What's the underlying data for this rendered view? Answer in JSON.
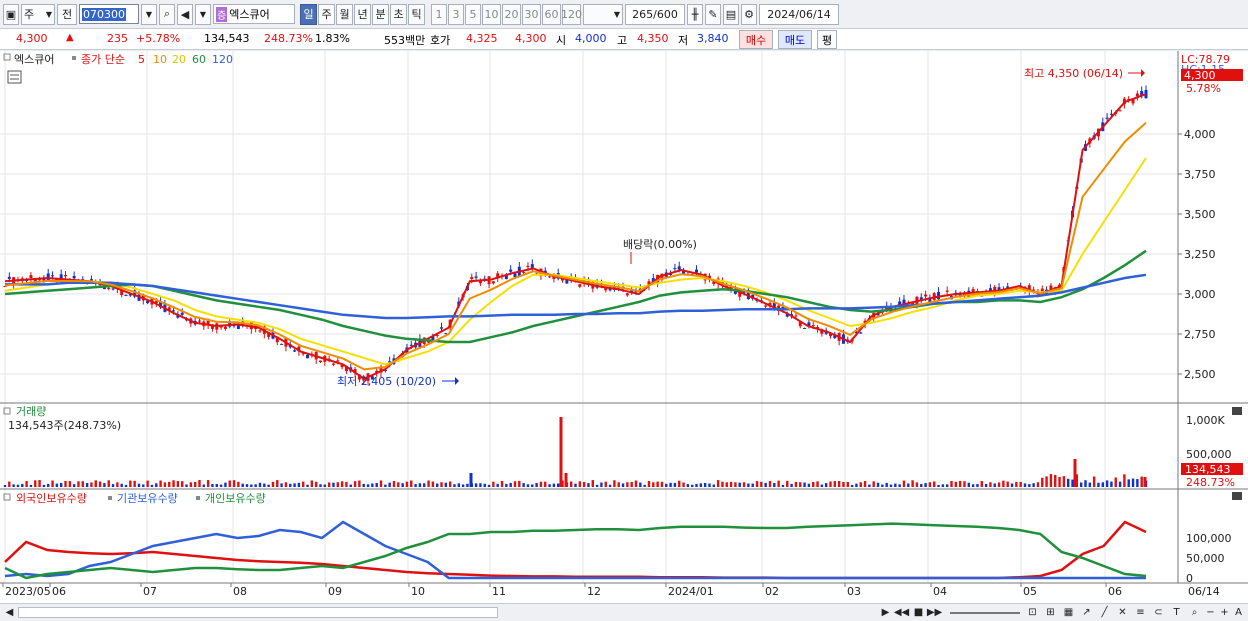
{
  "toolbar": {
    "period_type": "주",
    "prev_label": "전",
    "stock_code": "070300",
    "stock_name": "엑스큐어",
    "stock_tag": "증",
    "timeframes": [
      "일",
      "주",
      "월",
      "년",
      "분",
      "초",
      "틱"
    ],
    "active_timeframe": "일",
    "intervals": [
      "1",
      "3",
      "5",
      "10",
      "20",
      "30",
      "60",
      "120"
    ],
    "count_value": "265",
    "count_total": "/600",
    "date": "2024/06/14"
  },
  "quote": {
    "price": "4,300",
    "arrow": "▲",
    "change": "235",
    "change_pct": "+5.78%",
    "volume": "134,543",
    "volume_ratio": "248.73%",
    "turnover": "1.83%",
    "amount": "553백만",
    "ask_label": "호가",
    "ask": "4,325",
    "bid": "4,300",
    "open_label": "시",
    "open": "4,000",
    "high_label": "고",
    "high": "4,350",
    "low_label": "저",
    "low": "3,840",
    "buy_label": "매수",
    "sell_label": "매도",
    "avg_label": "평"
  },
  "legend": {
    "name": "엑스큐어",
    "ma_label": "종가 단순",
    "ma_periods": [
      "5",
      "10",
      "20",
      "60",
      "120"
    ],
    "ma_colors": [
      "#e01010",
      "#f08c00",
      "#f5e000",
      "#20903c",
      "#3060d8"
    ]
  },
  "price_panel": {
    "lc_label": "LC:78.79",
    "hc_label": "HC:1.15",
    "price_badge": "4,300",
    "pct_badge": "5.78%",
    "y_ticks": [
      "4,000",
      "3,750",
      "3,500",
      "3,250",
      "3,000",
      "2,750",
      "2,500"
    ],
    "high_annot": "최고 4,350 (06/14)",
    "low_annot": "최저 2,405 (10/20)",
    "div_annot": "배당락(0.00%)"
  },
  "volume_panel": {
    "title": "거래량",
    "subtitle": "134,543주(248.73%)",
    "y_ticks": [
      "1,000K",
      "500,000"
    ],
    "vol_badge": "134,543",
    "vol_pct": "248.73%"
  },
  "holdings_panel": {
    "series": [
      "외국인보유수량",
      "기관보유수량",
      "개인보유수량"
    ],
    "series_colors": [
      "#e01010",
      "#3060d8",
      "#20903c"
    ],
    "y_ticks": [
      "100,000",
      "50,000",
      "0"
    ]
  },
  "x_axis": [
    "2023/05",
    "06",
    "07",
    "08",
    "09",
    "10",
    "11",
    "12",
    "2024/01",
    "02",
    "03",
    "04",
    "05",
    "06",
    "06/14"
  ],
  "chart_data": {
    "type": "line",
    "title": "엑스큐어",
    "price_range": [
      2405,
      4350
    ],
    "series": [
      {
        "name": "5",
        "values": [
          3080,
          3090,
          3100,
          3090,
          3080,
          3050,
          3000,
          2950,
          2880,
          2820,
          2800,
          2810,
          2790,
          2720,
          2640,
          2600,
          2560,
          2470,
          2530,
          2650,
          2720,
          2790,
          3080,
          3090,
          3130,
          3160,
          3110,
          3080,
          3050,
          3030,
          3000,
          3110,
          3150,
          3120,
          3050,
          3000,
          2940,
          2880,
          2800,
          2760,
          2700,
          2860,
          2920,
          2950,
          2980,
          3000,
          3010,
          3020,
          3050,
          3000,
          3050,
          3900,
          4050,
          4200,
          4250
        ]
      },
      {
        "name": "20",
        "values": [
          3020,
          3040,
          3060,
          3070,
          3080,
          3070,
          3040,
          3000,
          2960,
          2900,
          2860,
          2840,
          2820,
          2780,
          2720,
          2680,
          2640,
          2600,
          2560,
          2600,
          2640,
          2700,
          2840,
          2950,
          3050,
          3120,
          3120,
          3100,
          3080,
          3060,
          3040,
          3070,
          3090,
          3100,
          3080,
          3050,
          3010,
          2960,
          2900,
          2850,
          2800,
          2820,
          2850,
          2890,
          2920,
          2960,
          2990,
          3000,
          3020,
          3010,
          3020,
          3250,
          3450,
          3650,
          3850
        ]
      },
      {
        "name": "60",
        "values": [
          3000,
          3010,
          3020,
          3030,
          3040,
          3050,
          3060,
          3050,
          3020,
          2990,
          2960,
          2940,
          2920,
          2900,
          2870,
          2840,
          2800,
          2770,
          2740,
          2720,
          2710,
          2700,
          2700,
          2730,
          2760,
          2800,
          2830,
          2860,
          2890,
          2920,
          2950,
          2990,
          3010,
          3020,
          3030,
          3020,
          3000,
          2980,
          2950,
          2920,
          2900,
          2890,
          2900,
          2920,
          2940,
          2950,
          2950,
          2960,
          2960,
          2950,
          2980,
          3030,
          3100,
          3180,
          3270
        ]
      },
      {
        "name": "120",
        "values": [
          3060,
          3060,
          3060,
          3070,
          3070,
          3070,
          3060,
          3050,
          3030,
          3010,
          2990,
          2970,
          2950,
          2930,
          2910,
          2890,
          2870,
          2860,
          2850,
          2850,
          2855,
          2860,
          2860,
          2865,
          2870,
          2870,
          2870,
          2875,
          2875,
          2880,
          2880,
          2890,
          2895,
          2895,
          2900,
          2905,
          2905,
          2905,
          2910,
          2910,
          2910,
          2915,
          2920,
          2930,
          2940,
          2950,
          2960,
          2970,
          2980,
          2990,
          3010,
          3040,
          3070,
          3100,
          3120
        ]
      }
    ],
    "holdings": [
      {
        "name": "외국인보유수량",
        "values": [
          40,
          90,
          70,
          65,
          62,
          60,
          62,
          65,
          60,
          55,
          50,
          45,
          42,
          40,
          38,
          35,
          30,
          25,
          20,
          15,
          12,
          10,
          8,
          6,
          5,
          4,
          4,
          3,
          3,
          3,
          3,
          2,
          2,
          2,
          1,
          1,
          1,
          0,
          0,
          0,
          0,
          0,
          0,
          0,
          0,
          0,
          0,
          0,
          2,
          5,
          20,
          60,
          80,
          140,
          115
        ]
      },
      {
        "name": "기관보유수량",
        "values": [
          5,
          10,
          5,
          10,
          30,
          40,
          60,
          80,
          90,
          100,
          110,
          100,
          105,
          120,
          115,
          100,
          140,
          110,
          80,
          60,
          40,
          0,
          0,
          0,
          0,
          0,
          0,
          0,
          0,
          0,
          0,
          0,
          0,
          0,
          0,
          0,
          0,
          0,
          0,
          0,
          0,
          0,
          0,
          0,
          0,
          0,
          0,
          0,
          0,
          0,
          0,
          0,
          0,
          0,
          0
        ]
      },
      {
        "name": "개인보유수량",
        "values": [
          25,
          0,
          10,
          15,
          20,
          25,
          20,
          15,
          20,
          25,
          25,
          22,
          20,
          20,
          25,
          30,
          25,
          40,
          55,
          75,
          90,
          110,
          110,
          115,
          115,
          118,
          118,
          120,
          122,
          122,
          120,
          125,
          128,
          128,
          128,
          126,
          125,
          125,
          128,
          130,
          132,
          134,
          136,
          134,
          132,
          130,
          128,
          125,
          120,
          110,
          65,
          50,
          30,
          10,
          5
        ]
      }
    ]
  },
  "scroll": {
    "nav_buttons": [
      "▶",
      "◀◀",
      "■",
      "▶▶"
    ]
  }
}
